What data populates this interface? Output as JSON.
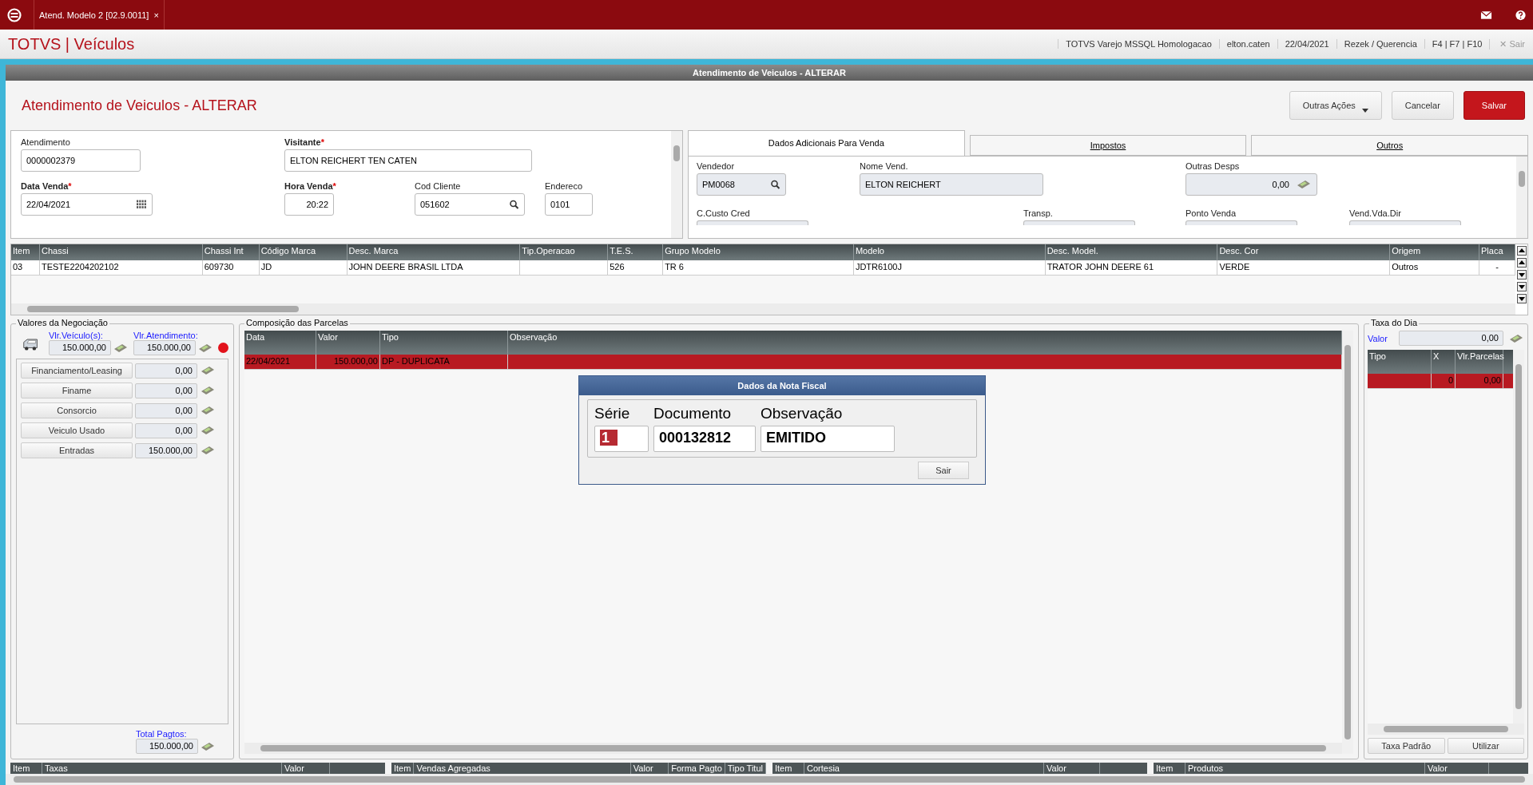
{
  "app_tab": {
    "label": "Atend. Modelo 2 [02.9.0011]",
    "close": "×"
  },
  "header": {
    "brand": "TOTVS | Veículos",
    "info": [
      "TOTVS Varejo MSSQL Homologacao",
      "elton.caten",
      "22/04/2021",
      "Rezek / Querencia",
      "F4 | F7 | F10"
    ],
    "exit_icon": "✕",
    "exit": "Sair"
  },
  "window_title": "Atendimento de Veiculos - ALTERAR",
  "page_title": "Atendimento de Veiculos - ALTERAR",
  "actions": [
    {
      "label": "Outras Ações",
      "kind": "menu"
    },
    {
      "label": "Cancelar",
      "kind": "plain"
    },
    {
      "label": "Salvar",
      "kind": "primary"
    }
  ],
  "required_mark": "*",
  "form_rows": [
    [
      {
        "label": "Atendimento",
        "required": false,
        "value": "0000002379"
      },
      {
        "label": "Visitante",
        "required": true,
        "value": "ELTON REICHERT TEN CATEN"
      }
    ],
    [
      {
        "label": "Data Venda",
        "required": true,
        "value": "22/04/2021"
      },
      {
        "label": "Hora Venda",
        "required": true,
        "value": "20:22"
      },
      {
        "label": "Cod Cliente",
        "required": false,
        "value": "051602"
      },
      {
        "label": "Endereco",
        "required": false,
        "value": "0101"
      }
    ]
  ],
  "tabs": [
    {
      "label": "Dados Adicionais Para Venda",
      "selected": true
    },
    {
      "label": "Impostos",
      "selected": false
    },
    {
      "label": "Outros",
      "selected": false
    }
  ],
  "tab_fields": [
    [
      {
        "label": "Vendedor",
        "value": "PM0068"
      },
      {
        "label": "Nome Vend.",
        "value": "ELTON REICHERT"
      },
      {
        "label": "Outras Desps",
        "value": "0,00"
      }
    ],
    [
      {
        "label": "C.Custo Cred"
      },
      {
        "label": "Transp."
      },
      {
        "label": "Ponto Venda"
      },
      {
        "label": "Vend.Vda.Dir"
      }
    ]
  ],
  "vehicle_grid": {
    "columns": [
      "Item",
      "Chassi",
      "Chassi Int",
      "Código Marca",
      "Desc. Marca",
      "Tip.Operacao",
      "T.E.S.",
      "Grupo Modelo",
      "Modelo",
      "Desc. Model.",
      "Desc. Cor",
      "Origem",
      "Placa"
    ],
    "rows": [
      {
        "selected": false,
        "cells": [
          "03",
          "TESTE2204202102",
          "609730",
          "JD",
          "JOHN DEERE BRASIL LTDA",
          null,
          "526",
          "TR 6",
          "JDTR6100J",
          "TRATOR JOHN DEERE 61",
          "VERDE",
          "Outros",
          "-"
        ]
      }
    ]
  },
  "valores": {
    "title": "Valores da Negociação",
    "vehicle_label": "Vlr.Veículo(s):",
    "vehicle_value": "150.000,00",
    "atendimento_label": "Vlr.Atendimento:",
    "atendimento_value": "150.000,00",
    "alert": true,
    "items": [
      {
        "label": "Financiamento/Leasing",
        "value": "0,00"
      },
      {
        "label": "Finame",
        "value": "0,00"
      },
      {
        "label": "Consorcio",
        "value": "0,00"
      },
      {
        "label": "Veiculo Usado",
        "value": "0,00"
      },
      {
        "label": "Entradas",
        "value": "150.000,00"
      }
    ],
    "total_label": "Total Pagtos:",
    "total_value": "150.000,00"
  },
  "parcelas": {
    "title": "Composição das Parcelas",
    "columns": [
      "Data",
      "Valor",
      "Tipo",
      "Observação"
    ],
    "rows": [
      {
        "selected": true,
        "cells": [
          "22/04/2021",
          "150.000,00",
          "DP - DUPLICATA",
          null
        ]
      }
    ]
  },
  "dialog": {
    "title": "Dados da Nota Fiscal",
    "fields": [
      {
        "label": "Série",
        "value": "1",
        "selected_text": true
      },
      {
        "label": "Documento",
        "value": "000132812",
        "selected_text": false
      },
      {
        "label": "Observação",
        "value": "EMITIDO",
        "selected_text": false
      }
    ],
    "button": "Sair"
  },
  "taxa": {
    "title": "Taxa do Dia",
    "value_label": "Valor",
    "value": "0,00",
    "columns": [
      "Tipo",
      "X",
      "Vlr.Parcelas"
    ],
    "rows": [
      {
        "selected": true,
        "cells": [
          null,
          "0",
          "0,00"
        ]
      }
    ],
    "buttons": [
      "Taxa Padrão",
      "Utilizar"
    ]
  },
  "bottom_grids": [
    [
      "Item",
      "Taxas",
      "Valor"
    ],
    [
      "Item",
      "Vendas Agregadas",
      "Valor",
      "Forma Pagto",
      "Tipo Titul"
    ],
    [
      "Item",
      "Cortesia",
      "Valor"
    ],
    [
      "Item",
      "Produtos",
      "Valor"
    ]
  ]
}
